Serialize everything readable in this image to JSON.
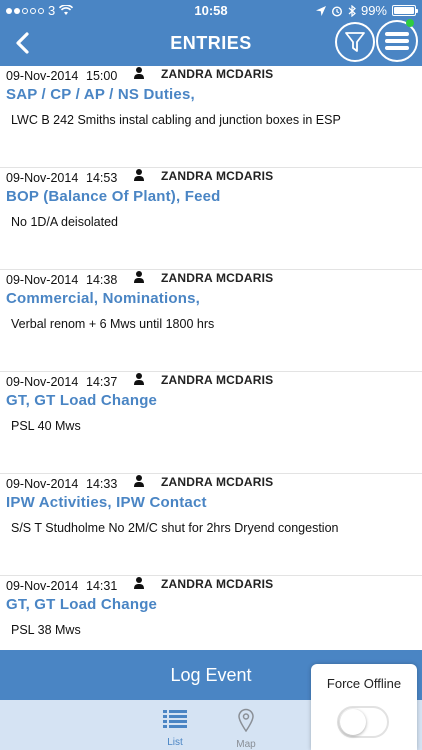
{
  "status_bar": {
    "carrier": "3",
    "time": "10:58",
    "battery": "99%",
    "battery_level": 0.99
  },
  "nav": {
    "title": "ENTRIES",
    "back_icon": "chevron-left-icon",
    "filter_icon": "funnel-icon",
    "menu_icon": "hamburger-menu-icon",
    "status_color": "#2ecc40"
  },
  "entries": [
    {
      "date": "09-Nov-2014",
      "time": "15:00",
      "author": "ZANDRA MCDARIS",
      "title": "SAP / CP / AP / NS Duties,",
      "description": "LWC B 242 Smiths instal cabling and junction boxes in ESP"
    },
    {
      "date": "09-Nov-2014",
      "time": "14:53",
      "author": "ZANDRA MCDARIS",
      "title": "BOP (Balance Of Plant), Feed",
      "description": "No 1D/A deisolated"
    },
    {
      "date": "09-Nov-2014",
      "time": "14:38",
      "author": "ZANDRA MCDARIS",
      "title": "Commercial, Nominations,",
      "description": "Verbal renom + 6 Mws until 1800 hrs"
    },
    {
      "date": "09-Nov-2014",
      "time": "14:37",
      "author": "ZANDRA MCDARIS",
      "title": "GT, GT Load Change",
      "description": "PSL 40 Mws"
    },
    {
      "date": "09-Nov-2014",
      "time": "14:33",
      "author": "ZANDRA MCDARIS",
      "title": "IPW Activities, IPW Contact",
      "description": "S/S T Studholme No 2M/C shut for 2hrs Dryend congestion"
    },
    {
      "date": "09-Nov-2014",
      "time": "14:31",
      "author": "ZANDRA MCDARIS",
      "title": "GT, GT Load Change",
      "description": "PSL 38 Mws"
    }
  ],
  "log_event": {
    "label": "Log Event"
  },
  "tabs": [
    {
      "label": "List",
      "icon": "list-icon",
      "active": true
    },
    {
      "label": "Map",
      "icon": "map-pin-icon",
      "active": false
    }
  ],
  "force_offline": {
    "label": "Force Offline",
    "enabled": false
  },
  "colors": {
    "primary": "#4a85c4",
    "tabbar": "#d5e3f3",
    "inactive_tab": "#8a8f96"
  }
}
